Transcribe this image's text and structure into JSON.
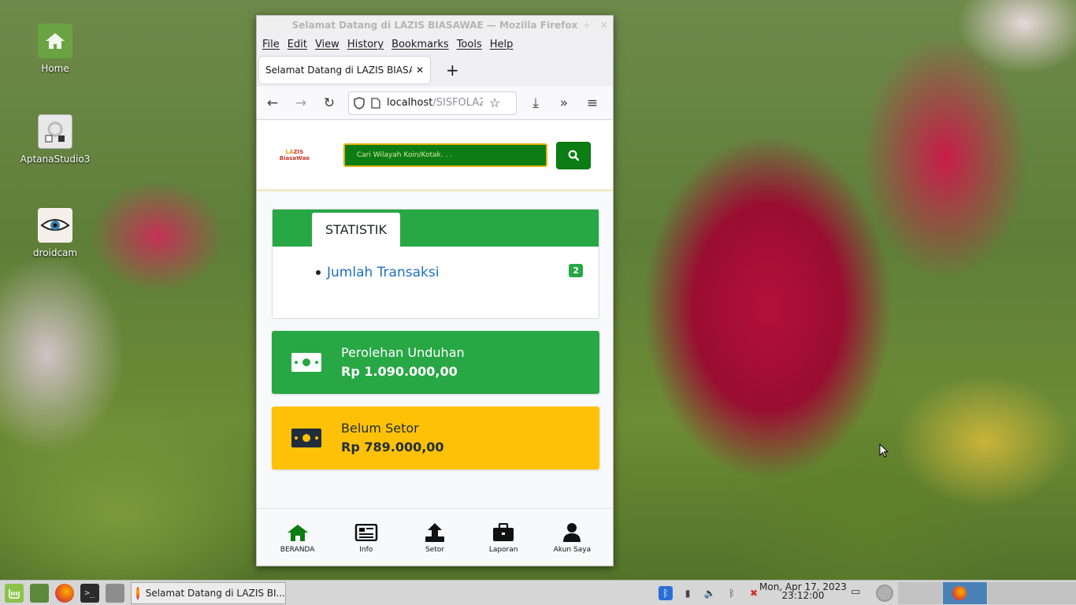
{
  "desktop": {
    "icons": [
      {
        "label": "Home",
        "icon": "home-folder-icon"
      },
      {
        "label": "AptanaStudio3",
        "icon": "aptana-icon"
      },
      {
        "label": "droidcam",
        "icon": "droidcam-icon"
      }
    ]
  },
  "window": {
    "title": "Selamat Datang di LAZIS BIASAWAE — Mozilla Firefox",
    "menu": [
      "File",
      "Edit",
      "View",
      "History",
      "Bookmarks",
      "Tools",
      "Help"
    ],
    "tab_title": "Selamat Datang di LAZIS BIASAWAE",
    "url_main": "localhost",
    "url_path": "/SISFOLAZIS"
  },
  "app": {
    "logo": {
      "line1_a": "LA",
      "line1_b": "ZIS",
      "line2": "BiasaWae"
    },
    "search_placeholder": "Cari Wilayah Koin/Kotak. . .",
    "stat_tab": "STATISTIK",
    "stat_item": "Jumlah Transaksi",
    "stat_badge": "2",
    "box1": {
      "label": "Perolehan Unduhan",
      "value": "Rp 1.090.000,00",
      "color": "#28a745"
    },
    "box2": {
      "label": "Belum Setor",
      "value": "Rp 789.000,00",
      "color": "#ffc107"
    },
    "nav": [
      {
        "label": "BERANDA",
        "icon": "home-icon"
      },
      {
        "label": "Info",
        "icon": "newspaper-icon"
      },
      {
        "label": "Setor",
        "icon": "upload-icon"
      },
      {
        "label": "Laporan",
        "icon": "briefcase-icon"
      },
      {
        "label": "Akun Saya",
        "icon": "user-icon"
      }
    ]
  },
  "taskbar": {
    "task_label": "Selamat Datang di LAZIS BI...",
    "date": "Mon, Apr 17, 2023",
    "time": "23:12:00"
  }
}
